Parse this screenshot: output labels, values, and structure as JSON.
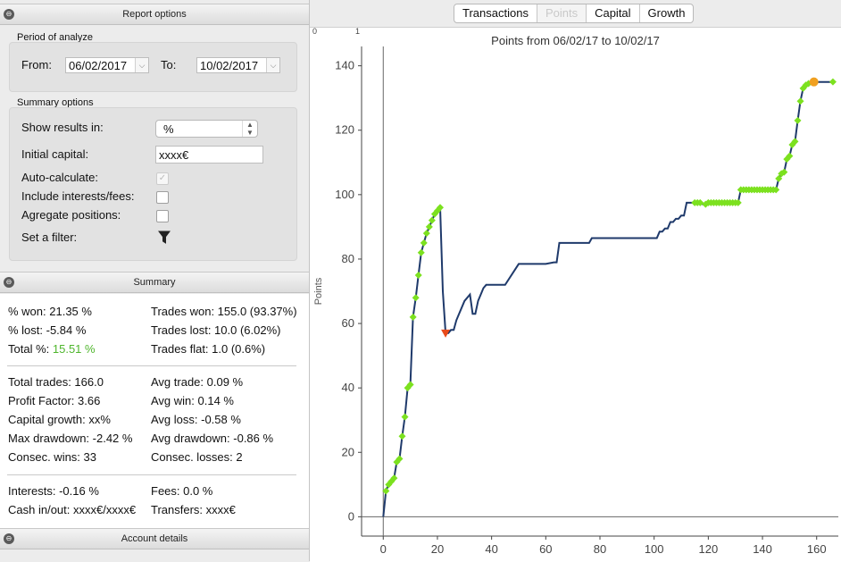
{
  "report_panel": {
    "title": "Report options",
    "period": {
      "title": "Period of analyze",
      "from_label": "From:",
      "from_value": "06/02/2017",
      "to_label": "To:",
      "to_value": "10/02/2017"
    },
    "summary_options": {
      "title": "Summary options",
      "show_results_label": "Show results in:",
      "show_results_value": "%",
      "initial_capital_label": "Initial capital:",
      "initial_capital_value": "xxxx€",
      "auto_calculate_label": "Auto-calculate:",
      "include_interests_label": "Include interests/fees:",
      "aggregate_label": "Agregate positions:",
      "filter_label": "Set a filter:"
    }
  },
  "summary_panel": {
    "title": "Summary",
    "won": "% won: 21.35 %",
    "lost": "% lost: -5.84 %",
    "total_label": "Total %:",
    "total_value": "15.51 %",
    "trades_won": "Trades won: 155.0 (93.37%)",
    "trades_lost": "Trades lost: 10.0 (6.02%)",
    "trades_flat": "Trades flat: 1.0 (0.6%)",
    "total_trades": "Total trades: 166.0",
    "profit_factor": "Profit Factor: 3.66",
    "capital_growth": "Capital growth: xx%",
    "max_drawdown": "Max drawdown: -2.42 %",
    "consec_wins": "Consec. wins: 33",
    "avg_trade": "Avg trade: 0.09 %",
    "avg_win": "Avg win: 0.14 %",
    "avg_loss": "Avg loss: -0.58 %",
    "avg_drawdown": "Avg drawdown: -0.86 %",
    "consec_losses": "Consec. losses: 2",
    "interests": "Interests: -0.16 %",
    "cash_in_out": "Cash in/out: xxxx€/xxxx€",
    "fees": "Fees: 0.0 %",
    "transfers": "Transfers: xxxx€"
  },
  "account_panel": {
    "title": "Account details"
  },
  "tabs": [
    "Transactions",
    "Points",
    "Capital",
    "Growth"
  ],
  "selected_tab": "Points",
  "scroll_marks": [
    "0",
    "1"
  ],
  "chart_data": {
    "type": "line",
    "title": "Points from 06/02/17 to 10/02/17",
    "ylabel": "Points",
    "xlabel": "",
    "xlim": [
      -8,
      168
    ],
    "ylim": [
      -6,
      146
    ],
    "x_ticks": [
      0,
      20,
      40,
      60,
      80,
      100,
      120,
      140,
      160
    ],
    "y_ticks": [
      0,
      20,
      40,
      60,
      80,
      100,
      120,
      140
    ],
    "line_color": "#1f3a6b",
    "marker_color": "#7ce11f",
    "max_marker_color": "#f0a020",
    "min_marker_color": "#e84a1a",
    "series": [
      {
        "x": [
          0,
          1,
          2,
          3,
          4,
          5,
          6,
          7,
          8,
          9,
          10,
          11,
          12,
          13,
          14,
          15,
          16,
          17,
          18,
          19,
          20,
          21,
          22,
          23,
          24,
          25,
          26,
          27,
          28,
          30,
          32,
          33,
          34,
          35,
          36,
          37,
          38,
          40,
          42,
          45,
          50,
          55,
          60,
          63,
          64,
          65,
          70,
          76,
          77,
          80,
          85,
          90,
          95,
          100,
          101,
          102,
          103,
          104,
          105,
          106,
          107,
          108,
          109,
          110,
          111,
          112,
          113,
          114,
          115,
          116,
          117,
          118,
          119,
          120,
          121,
          122,
          123,
          124,
          125,
          126,
          127,
          128,
          129,
          130,
          131,
          132,
          133,
          134,
          135,
          136,
          137,
          138,
          139,
          140,
          141,
          142,
          143,
          144,
          145,
          146,
          147,
          148,
          149,
          150,
          151,
          152,
          153,
          154,
          155,
          156,
          157,
          158,
          159,
          160,
          162,
          164,
          166
        ],
        "y": [
          0,
          8,
          10,
          11,
          12,
          17,
          18,
          25,
          31,
          40,
          41,
          62,
          68,
          75,
          82,
          85,
          88,
          90,
          92,
          94,
          95,
          96,
          70,
          57,
          57,
          58,
          58,
          61,
          63,
          67,
          69,
          63,
          63,
          67,
          69,
          71,
          72,
          72,
          72,
          72,
          78.5,
          78.5,
          78.5,
          79,
          79,
          85,
          85,
          85,
          86.5,
          86.5,
          86.5,
          86.5,
          86.5,
          86.5,
          86.5,
          88.5,
          88.5,
          89.5,
          89.5,
          91.5,
          91.5,
          92.5,
          92.5,
          93.5,
          93.5,
          97.5,
          97.5,
          97.5,
          97.5,
          97.5,
          97.5,
          97,
          97,
          97.5,
          97.5,
          97.5,
          97.5,
          97.5,
          97.5,
          97.5,
          97.5,
          97.5,
          97.5,
          97.5,
          97.5,
          101.5,
          101.5,
          101.5,
          101.5,
          101.5,
          101.5,
          101.5,
          101.5,
          101.5,
          101.5,
          101.5,
          101.5,
          101.5,
          101.5,
          105,
          106.5,
          107,
          111,
          112,
          115.5,
          116.5,
          123,
          129,
          133,
          134,
          134.5,
          134.5,
          135,
          135,
          135,
          135,
          135
        ]
      }
    ],
    "max_point": [
      159,
      135
    ],
    "min_point": [
      23,
      57
    ]
  }
}
